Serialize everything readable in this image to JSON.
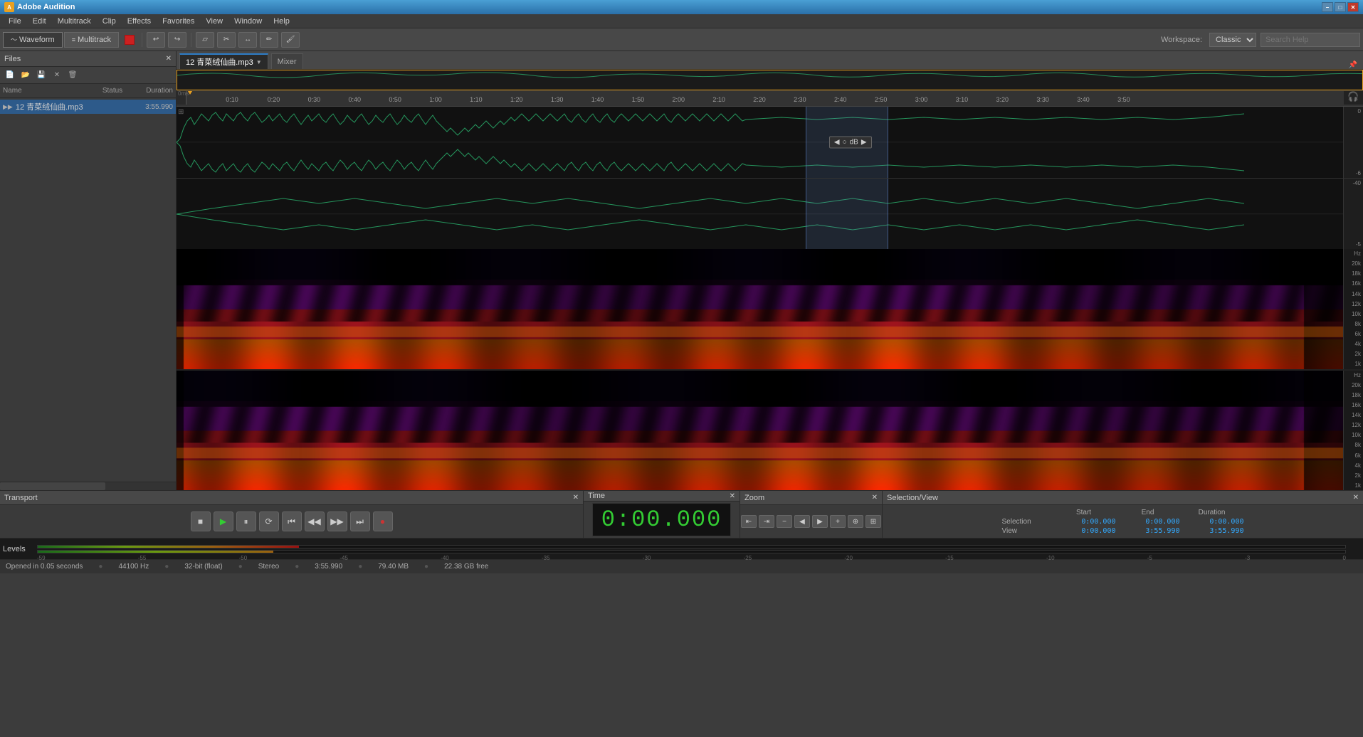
{
  "app": {
    "title": "Adobe Audition",
    "version": ""
  },
  "titleBar": {
    "title": "Adobe Audition",
    "minimize": "–",
    "maximize": "□",
    "close": "✕"
  },
  "menuBar": {
    "items": [
      "File",
      "Edit",
      "Multitrack",
      "Clip",
      "Effects",
      "Favorites",
      "View",
      "Window",
      "Help"
    ]
  },
  "toolbar": {
    "waveformLabel": "Waveform",
    "multitrackLabel": "Multitrack",
    "workspaceLabel": "Workspace:",
    "workspaceValue": "Classic",
    "searchPlaceholder": "Search Help"
  },
  "filesPanel": {
    "title": "Files",
    "columns": {
      "name": "Name",
      "status": "Status",
      "duration": "Duration"
    },
    "files": [
      {
        "name": "12 青菜绒仙曲.mp3",
        "status": "",
        "duration": "3:55.990",
        "selected": true
      }
    ]
  },
  "editor": {
    "tabLabel": "12 青菜绒仙曲.mp3",
    "mixerLabel": "Mixer",
    "ruler": {
      "start": "0ms",
      "marks": [
        "0:10",
        "0:20",
        "0:30",
        "0:40",
        "0:50",
        "1:00",
        "1:10",
        "1:20",
        "1:30",
        "1:40",
        "1:50",
        "2:00",
        "2:10",
        "2:20",
        "2:30",
        "2:40",
        "2:50",
        "3:00",
        "3:10",
        "3:20",
        "3:30",
        "3:40",
        "3:50"
      ]
    },
    "dbScale": {
      "ch1": [
        "0",
        "-6"
      ],
      "ch2": [
        "-40",
        "-5"
      ]
    },
    "selection": {
      "start_x_pct": 53,
      "width_pct": 7
    },
    "playhead_pct": 0
  },
  "spectrogramSection": {
    "ch1Hz": [
      "20k",
      "18k",
      "16k",
      "14k",
      "12k",
      "10k",
      "8k",
      "6k",
      "4k",
      "2k",
      "1k"
    ],
    "ch2Hz": [
      "20k",
      "18k",
      "16k",
      "14k",
      "12k",
      "10k",
      "8k",
      "6k",
      "4k",
      "2k",
      "1k"
    ]
  },
  "transport": {
    "title": "Transport",
    "buttons": {
      "stop": "■",
      "play": "▶",
      "pause": "⏸",
      "loop": "↺",
      "rewind_start": "⏮",
      "rewind": "◀◀",
      "forward": "▶▶",
      "forward_end": "⏭",
      "record": "●"
    }
  },
  "time": {
    "title": "Time",
    "display": "0:00.000"
  },
  "zoom": {
    "title": "Zoom",
    "buttons": [
      "⇤",
      "⇥",
      "—",
      "←",
      "→",
      "+",
      "−",
      "⊕"
    ]
  },
  "selectionView": {
    "title": "Selection/View",
    "headers": [
      "Start",
      "End",
      "Duration"
    ],
    "rows": [
      {
        "label": "Selection",
        "start": "0:00.000",
        "end": "0:00.000",
        "duration": "0:00.000"
      },
      {
        "label": "View",
        "start": "0:00.000",
        "end": "3:55.990",
        "duration": "3:55.990"
      }
    ]
  },
  "levels": {
    "title": "Levels",
    "ticks": [
      "-59",
      "-55",
      "-50",
      "-45",
      "-40",
      "-35",
      "-30",
      "-25",
      "-20",
      "-15",
      "-10",
      "-5",
      "-3",
      "0"
    ]
  },
  "statusBar": {
    "openedIn": "Opened in 0.05 seconds",
    "sampleRate": "44100 Hz",
    "bitDepth": "32-bit (float)",
    "channels": "Stereo",
    "duration": "3:55.990",
    "fileSize": "79.40 MB",
    "freeSpace": "22.38 GB free"
  }
}
